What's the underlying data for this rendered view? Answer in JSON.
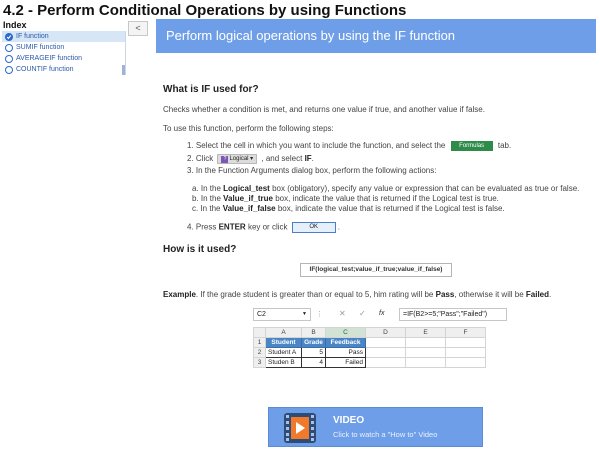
{
  "page": {
    "title": "4.2 - Perform Conditional Operations by using Functions"
  },
  "index": {
    "label": "Index",
    "items": [
      {
        "label": "IF function",
        "active": true
      },
      {
        "label": "SUMIF function",
        "active": false
      },
      {
        "label": "AVERAGEIF function",
        "active": false
      },
      {
        "label": "COUNTIF function",
        "active": false
      }
    ],
    "collapse_label": "<"
  },
  "header": {
    "title": "Perform logical operations by using the IF function"
  },
  "content": {
    "what_heading": "What is IF used for?",
    "what_text": "Checks whether a condition is met, and returns one value if true, and another value if false.",
    "use_intro": "To use this function, perform the following steps:",
    "step1_a": "1. Select the cell in which you want to include the function, and select the",
    "step1_tab": "Formulas",
    "step1_b": "tab.",
    "step2_a": "2. Click",
    "step2_btn": "Logical",
    "step2_b": ", and select",
    "step2_bold": "IF",
    "step2_c": ".",
    "step3": "3. In the Function Arguments dialog box, perform the following actions:",
    "sub_a_pre": "a. In the",
    "sub_a_bold": "Logical_test",
    "sub_a_post": "box (obligatory), specify any value or expression that can be evaluated as true or false.",
    "sub_b_pre": "b. In the",
    "sub_b_bold": "Value_if_true",
    "sub_b_post": "box, indicate the value that is returned if the Logical test is true.",
    "sub_c_pre": "c. In the",
    "sub_c_bold": "Value_if_false",
    "sub_c_post": "box, indicate the value that is returned if the Logical test is false.",
    "step4_a": "4. Press",
    "step4_bold": "ENTER",
    "step4_b": "key or click",
    "step4_btn": "OK",
    "step4_c": ".",
    "how_heading": "How is it used?",
    "syntax": "IF(logical_test;value_if_true;value_if_false)",
    "example_bold": "Example",
    "example_a": ". If the grade student is greater than or equal to 5, him rating will be",
    "example_pass": "Pass",
    "example_b": ", otherwise it will be",
    "example_failed": "Failed",
    "example_c": "."
  },
  "excel": {
    "name_box": "C2",
    "formula": "=IF(B2>=5;\"Pass\";\"Failed\")",
    "fx_label": "fx",
    "columns": [
      "A",
      "B",
      "C",
      "D",
      "E",
      "F"
    ],
    "rows": [
      {
        "num": "1",
        "a": "Student",
        "b": "Grade",
        "c": "Feedback"
      },
      {
        "num": "2",
        "a": "Student A",
        "b": "5",
        "c": "Pass"
      },
      {
        "num": "3",
        "a": "Studen B",
        "b": "4",
        "c": "Failed"
      }
    ]
  },
  "video": {
    "title": "VIDEO",
    "subtitle": "Click to watch a \"How to\" Video"
  }
}
